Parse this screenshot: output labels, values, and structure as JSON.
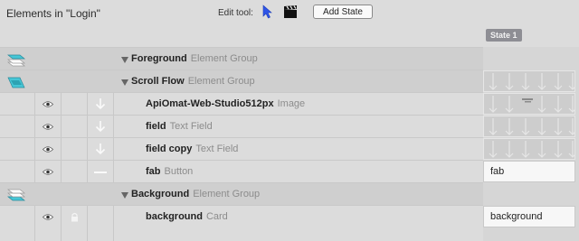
{
  "header": {
    "title": "Elements in \"Login\"",
    "edit_tool_label": "Edit tool:",
    "add_state_label": "Add State",
    "state_column": "State 1"
  },
  "elements": [
    {
      "name": "Foreground",
      "type": "Element Group"
    },
    {
      "name": "Scroll Flow",
      "type": "Element Group"
    },
    {
      "name": "ApiOmat-Web-Studio512px",
      "type": "Image"
    },
    {
      "name": "field",
      "type": "Text Field"
    },
    {
      "name": "field copy",
      "type": "Text Field"
    },
    {
      "name": "fab",
      "type": "Button"
    },
    {
      "name": "Background",
      "type": "Element Group"
    },
    {
      "name": "background",
      "type": "Card"
    }
  ],
  "state_cells": {
    "fab": "fab",
    "background": "background"
  },
  "icons": {
    "pointer_tool": "pointer-arrow-icon",
    "animation_tool": "clapperboard-icon",
    "visibility": "eye-icon",
    "lock": "lock-icon",
    "flow_down": "arrow-down-icon",
    "no_flow": "dash-icon",
    "layer_group": "layers-icon"
  },
  "colors": {
    "accent_blue": "#2f6fe0",
    "layer_teal": "#46c6d6",
    "state_header": "#8e8e94"
  }
}
